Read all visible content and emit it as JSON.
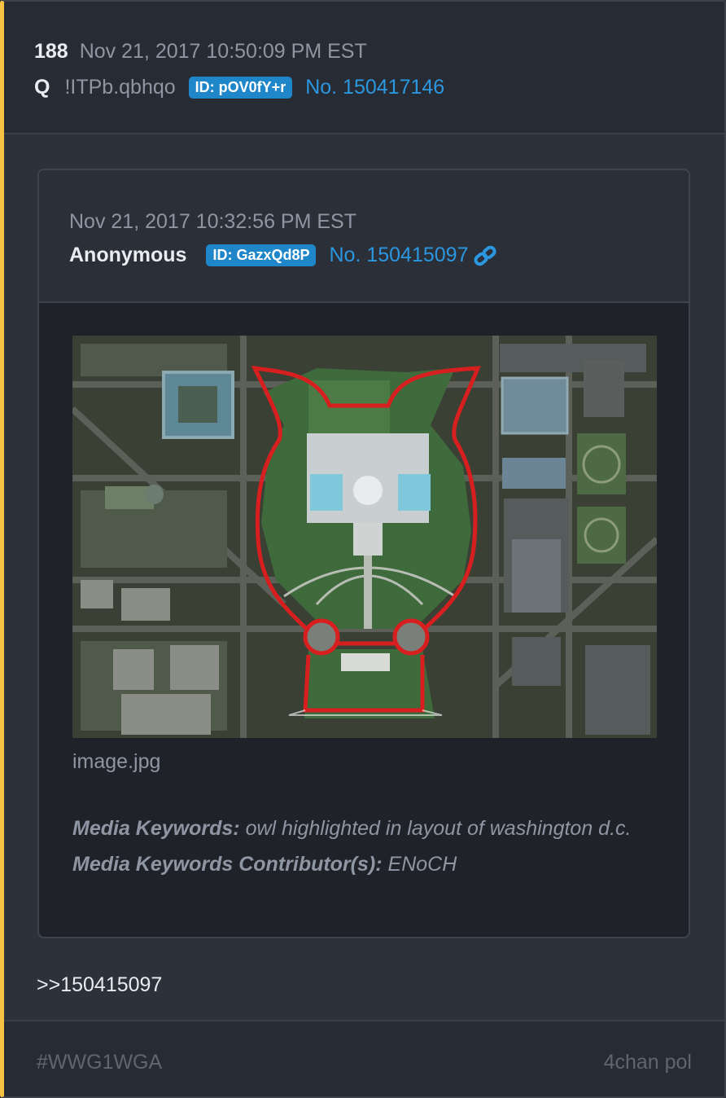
{
  "post": {
    "number": "188",
    "timestamp": "Nov 21, 2017 10:50:09 PM EST",
    "author": "Q",
    "tripcode": "!ITPb.qbhqo",
    "id_badge": "ID: pOV0fY+r",
    "post_no": "No. 150417146"
  },
  "quoted": {
    "timestamp": "Nov 21, 2017 10:32:56 PM EST",
    "author": "Anonymous",
    "id_badge": "ID: GazxQd8P",
    "post_no": "No. 150415097",
    "link_icon": "chain-link-icon",
    "image": {
      "filename": "image.jpg",
      "description_icon": "aerial-map-owl-outline"
    },
    "keywords_label": "Media Keywords:",
    "keywords_value": "owl highlighted in layout of washington d.c.",
    "contributors_label": "Media Keywords Contributor(s):",
    "contributors_value": "ENoCH"
  },
  "reply_text": ">>150415097",
  "footer": {
    "hashtag": "#WWG1WGA",
    "source": "4chan pol"
  },
  "colors": {
    "accent_bar": "#f5c242",
    "badge": "#1f86c9",
    "link": "#2b97e0",
    "owl_outline": "#d81f1f"
  }
}
